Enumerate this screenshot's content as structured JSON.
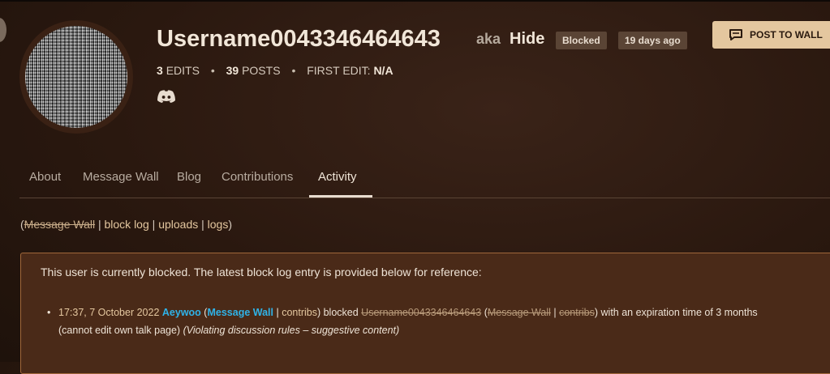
{
  "profile": {
    "username": "Username0043346464643",
    "aka_label": "aka",
    "aka_name": "Hide",
    "badge_blocked": "Blocked",
    "badge_age": "19 days ago",
    "stats": {
      "edits_count": "3",
      "edits_label": "EDITS",
      "posts_count": "39",
      "posts_label": "POSTS",
      "first_edit_label": "FIRST EDIT:",
      "first_edit_value": "N/A",
      "separator": "•"
    },
    "social_icon": "discord-icon"
  },
  "actions": {
    "post_to_wall": "POST TO WALL",
    "post_icon": "message-icon"
  },
  "tabs": [
    {
      "label": "About"
    },
    {
      "label": "Message Wall"
    },
    {
      "label": "Blog"
    },
    {
      "label": "Contributions"
    },
    {
      "label": "Activity",
      "active": true
    }
  ],
  "links": {
    "open_paren": "(",
    "message_wall": "Message Wall",
    "sep": "|",
    "block_log": "block log",
    "uploads": "uploads",
    "logs": "logs",
    "close_paren": ")"
  },
  "notice": {
    "text": "This user is currently blocked. The latest block log entry is provided below for reference:",
    "entry": {
      "timestamp": "17:37, 7 October 2022",
      "blocker": "Aeywoo",
      "open_paren": " (",
      "blocker_wall": "Message Wall",
      "sep": " | ",
      "blocker_contribs": "contribs",
      "action": ") blocked ",
      "target": "Username0043346464643",
      "open_paren2": " (",
      "target_wall": "Message Wall",
      "sep2": " | ",
      "target_contribs": "contribs",
      "expiry": ") with an expiration time of 3 months",
      "restriction": "(cannot edit own talk page) ",
      "reason": "(Violating discussion rules – suggestive content)"
    }
  },
  "colors": {
    "accent_button": "#e4c79f",
    "link_user": "#2fb3e8",
    "notice_bg": "#4a2a18",
    "notice_border": "#a0673a"
  }
}
